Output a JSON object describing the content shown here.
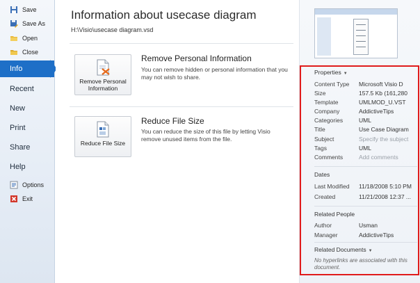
{
  "nav": {
    "save": "Save",
    "save_as": "Save As",
    "open": "Open",
    "close": "Close",
    "info": "Info",
    "recent": "Recent",
    "new": "New",
    "print": "Print",
    "share": "Share",
    "help": "Help",
    "options": "Options",
    "exit": "Exit"
  },
  "main": {
    "title": "Information about usecase diagram",
    "path": "H:\\Visio\\usecase diagram.vsd",
    "sections": [
      {
        "button_label": "Remove Personal Information",
        "title": "Remove Personal Information",
        "description": "You can remove hidden or personal information that you may not wish to share."
      },
      {
        "button_label": "Reduce File Size",
        "title": "Reduce File Size",
        "description": "You can reduce the size of this file by letting Visio remove unused items from the file."
      }
    ]
  },
  "properties": {
    "header": "Properties",
    "rows": [
      {
        "label": "Content Type",
        "value": "Microsoft Visio D"
      },
      {
        "label": "Size",
        "value": "157.5 Kb (161,280"
      },
      {
        "label": "Template",
        "value": "UMLMOD_U.VST"
      },
      {
        "label": "Company",
        "value": "AddictiveTips"
      },
      {
        "label": "Categories",
        "value": "UML"
      },
      {
        "label": "Title",
        "value": "Use Case Diagram"
      },
      {
        "label": "Subject",
        "value": "Specify the subject"
      },
      {
        "label": "Tags",
        "value": "UML"
      },
      {
        "label": "Comments",
        "value": "Add comments"
      }
    ],
    "dates_header": "Dates",
    "dates": [
      {
        "label": "Last Modified",
        "value": "11/18/2008 5:10 PM"
      },
      {
        "label": "Created",
        "value": "11/21/2008 12:37 ..."
      }
    ],
    "people_header": "Related People",
    "people": [
      {
        "label": "Author",
        "value": "Usman"
      },
      {
        "label": "Manager",
        "value": "AddictiveTips"
      }
    ],
    "docs_header": "Related Documents",
    "docs_note": "No hyperlinks are associated with this document."
  },
  "colors": {
    "accent": "#1e6fc7",
    "highlight_border": "#e01b1b"
  }
}
